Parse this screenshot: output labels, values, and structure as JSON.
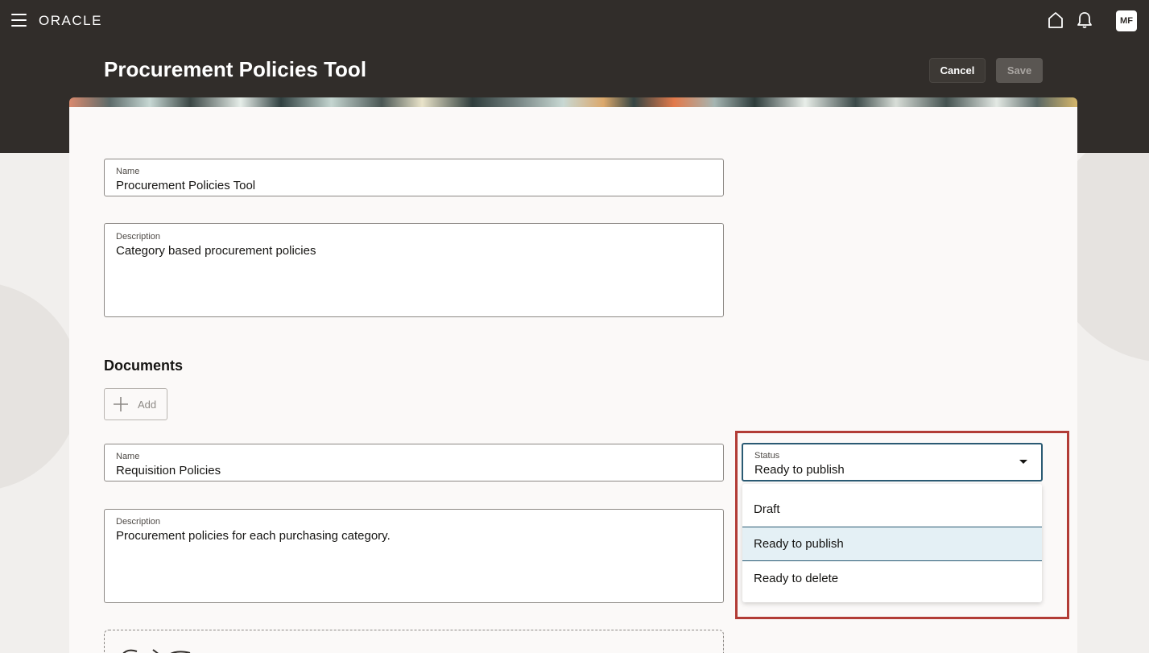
{
  "header": {
    "logo_text": "ORACLE",
    "avatar_initials": "MF",
    "icons": [
      "menu-icon",
      "home-icon",
      "bell-icon"
    ]
  },
  "page": {
    "title": "Procurement Policies Tool",
    "cancel_label": "Cancel",
    "save_label": "Save"
  },
  "tool": {
    "name_label": "Name",
    "name_value": "Procurement Policies Tool",
    "description_label": "Description",
    "description_value": "Category based procurement policies"
  },
  "documents": {
    "section_title": "Documents",
    "add_label": "Add",
    "item": {
      "name_label": "Name",
      "name_value": "Requisition Policies",
      "description_label": "Description",
      "description_value": "Procurement policies for each purchasing category.",
      "status_label": "Status",
      "status_value": "Ready to publish",
      "status_options": [
        "Draft",
        "Ready to publish",
        "Ready to delete"
      ]
    }
  },
  "colors": {
    "header_bg": "#312d2a",
    "card_bg": "#fbf9f8",
    "focus_border": "#2a5a73",
    "selected_option_bg": "#e4f0f5",
    "highlight_border": "#b23c36"
  }
}
